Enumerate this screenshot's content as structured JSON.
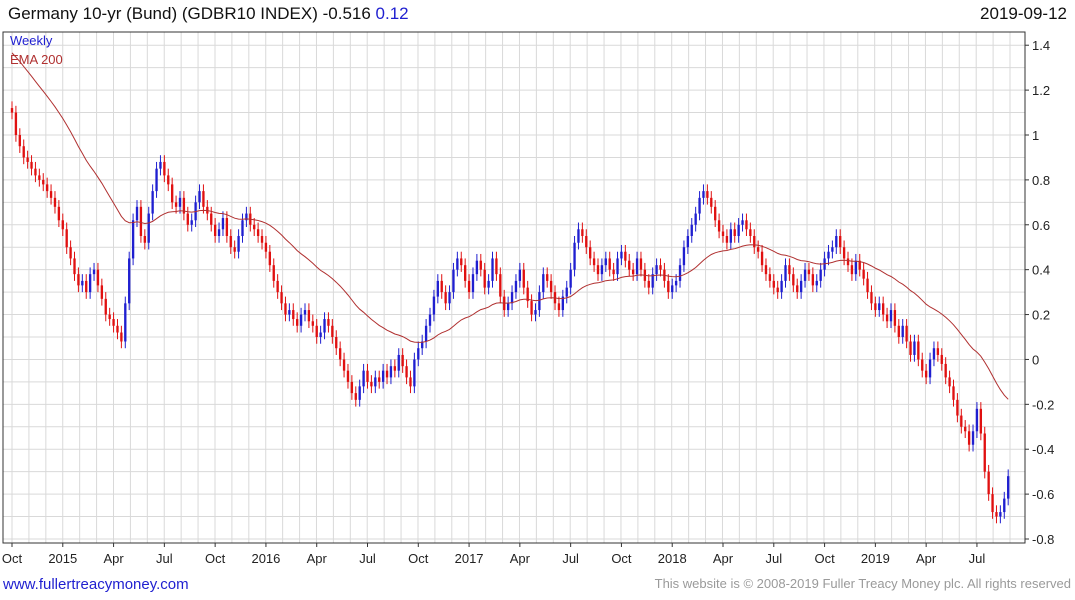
{
  "header": {
    "title": "Germany 10-yr (Bund)  (GDBR10 INDEX)",
    "last_value": "-0.516",
    "change": "0.12",
    "date": "2019-09-12"
  },
  "footer": {
    "site": "www.fullertreacymoney.com",
    "copyright": "This website is © 2008-2019 Fuller Treacy Money plc. All rights reserved"
  },
  "colors": {
    "up": "#1f1fd0",
    "down": "#e01010",
    "ema": "#b03030",
    "grid": "#d9d9d9"
  },
  "chart_data": {
    "type": "candlestick",
    "frequency_label": "Weekly",
    "ema_label": "EMA 200",
    "y_ticks": [
      "1.4",
      "1.2",
      "1",
      "0.8",
      "0.6",
      "0.4",
      "0.2",
      "0",
      "-0.2",
      "-0.4",
      "-0.6",
      "-0.8"
    ],
    "y_tick_values": [
      1.4,
      1.2,
      1.0,
      0.8,
      0.6,
      0.4,
      0.2,
      0.0,
      -0.2,
      -0.4,
      -0.6,
      -0.8
    ],
    "ylim": [
      -0.8,
      1.45
    ],
    "x_ticks": [
      "Oct",
      "2015",
      "Apr",
      "Jul",
      "Oct",
      "2016",
      "Apr",
      "Jul",
      "Oct",
      "2017",
      "Apr",
      "Jul",
      "Oct",
      "2018",
      "Apr",
      "Jul",
      "Oct",
      "2019",
      "Apr",
      "Jul"
    ],
    "x_tick_weeks": [
      1,
      14,
      27,
      40,
      53,
      66,
      79,
      92,
      105,
      118,
      131,
      144,
      157,
      170,
      183,
      196,
      209,
      222,
      235,
      248
    ],
    "weeks_total": 258,
    "close": [
      1.1,
      1.0,
      0.95,
      0.9,
      0.88,
      0.85,
      0.82,
      0.8,
      0.78,
      0.75,
      0.72,
      0.68,
      0.62,
      0.58,
      0.5,
      0.45,
      0.38,
      0.33,
      0.35,
      0.3,
      0.38,
      0.4,
      0.33,
      0.27,
      0.2,
      0.18,
      0.15,
      0.12,
      0.08,
      0.25,
      0.45,
      0.62,
      0.68,
      0.55,
      0.52,
      0.65,
      0.75,
      0.85,
      0.88,
      0.82,
      0.78,
      0.7,
      0.68,
      0.72,
      0.65,
      0.6,
      0.62,
      0.7,
      0.75,
      0.68,
      0.65,
      0.6,
      0.55,
      0.58,
      0.63,
      0.55,
      0.5,
      0.48,
      0.55,
      0.62,
      0.65,
      0.6,
      0.58,
      0.55,
      0.52,
      0.48,
      0.42,
      0.35,
      0.3,
      0.25,
      0.2,
      0.22,
      0.18,
      0.15,
      0.2,
      0.22,
      0.17,
      0.15,
      0.1,
      0.12,
      0.18,
      0.15,
      0.1,
      0.05,
      0.0,
      -0.05,
      -0.1,
      -0.15,
      -0.18,
      -0.12,
      -0.05,
      -0.1,
      -0.12,
      -0.08,
      -0.1,
      -0.05,
      -0.08,
      -0.03,
      -0.05,
      0.02,
      -0.03,
      -0.08,
      -0.12,
      0.0,
      0.05,
      0.08,
      0.15,
      0.2,
      0.28,
      0.35,
      0.3,
      0.25,
      0.3,
      0.4,
      0.45,
      0.42,
      0.35,
      0.3,
      0.38,
      0.44,
      0.4,
      0.32,
      0.35,
      0.45,
      0.38,
      0.28,
      0.22,
      0.25,
      0.3,
      0.35,
      0.4,
      0.32,
      0.26,
      0.2,
      0.22,
      0.3,
      0.38,
      0.35,
      0.3,
      0.25,
      0.22,
      0.28,
      0.32,
      0.4,
      0.52,
      0.58,
      0.55,
      0.5,
      0.45,
      0.42,
      0.38,
      0.42,
      0.45,
      0.4,
      0.38,
      0.45,
      0.48,
      0.44,
      0.4,
      0.38,
      0.45,
      0.4,
      0.35,
      0.32,
      0.38,
      0.42,
      0.4,
      0.35,
      0.3,
      0.33,
      0.35,
      0.42,
      0.5,
      0.55,
      0.6,
      0.65,
      0.72,
      0.75,
      0.72,
      0.68,
      0.62,
      0.57,
      0.55,
      0.52,
      0.58,
      0.55,
      0.6,
      0.62,
      0.58,
      0.55,
      0.5,
      0.48,
      0.42,
      0.38,
      0.35,
      0.32,
      0.3,
      0.35,
      0.42,
      0.38,
      0.33,
      0.3,
      0.35,
      0.4,
      0.38,
      0.33,
      0.35,
      0.4,
      0.45,
      0.48,
      0.5,
      0.55,
      0.5,
      0.45,
      0.42,
      0.38,
      0.44,
      0.4,
      0.36,
      0.3,
      0.25,
      0.22,
      0.25,
      0.2,
      0.17,
      0.22,
      0.15,
      0.1,
      0.15,
      0.08,
      0.02,
      0.08,
      0.0,
      -0.05,
      -0.08,
      0.0,
      0.05,
      0.02,
      -0.02,
      -0.08,
      -0.12,
      -0.18,
      -0.25,
      -0.3,
      -0.32,
      -0.38,
      -0.32,
      -0.22,
      -0.33,
      -0.5,
      -0.6,
      -0.68,
      -0.7,
      -0.68,
      -0.62,
      -0.52
    ]
  }
}
